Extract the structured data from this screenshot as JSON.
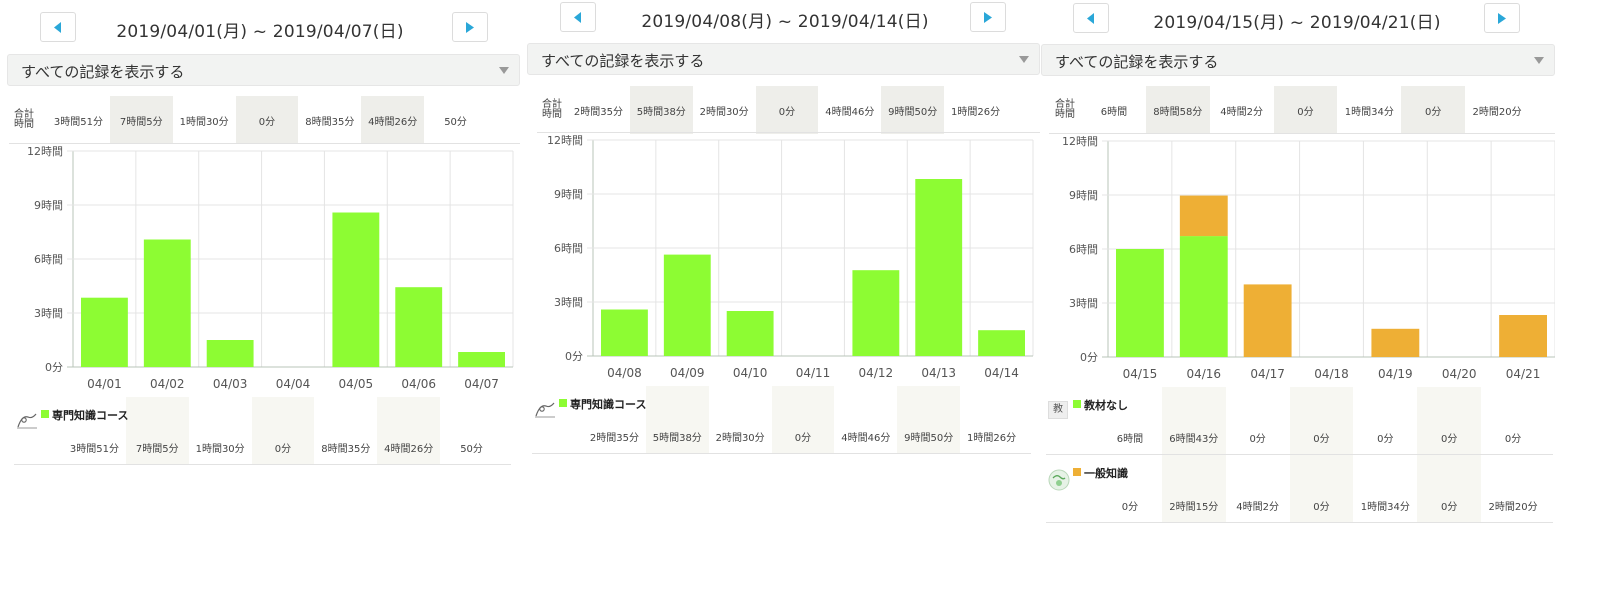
{
  "filter_label": "すべての記録を表示する",
  "total_label": "合計時間",
  "colors": {
    "green": "#8dfc33",
    "orange": "#eeaf35",
    "grid": "#e4e4e4",
    "axis": "#b8c4b8"
  },
  "panels": [
    {
      "title": "2019/04/01(月) ~ 2019/04/07(日)",
      "totals": [
        "3時間51分",
        "7時間5分",
        "1時間30分",
        "0分",
        "8時間35分",
        "4時間26分",
        "50分"
      ],
      "legend": [
        {
          "name": "専門知識コース",
          "icon": "course-icon",
          "color": "green",
          "values": [
            "3時間51分",
            "7時間5分",
            "1時間30分",
            "0分",
            "8時間35分",
            "4時間26分",
            "50分"
          ]
        }
      ]
    },
    {
      "title": "2019/04/08(月) ~ 2019/04/14(日)",
      "totals": [
        "2時間35分",
        "5時間38分",
        "2時間30分",
        "0分",
        "4時間46分",
        "9時間50分",
        "1時間26分"
      ],
      "legend": [
        {
          "name": "専門知識コース",
          "icon": "course-icon",
          "color": "green",
          "values": [
            "2時間35分",
            "5時間38分",
            "2時間30分",
            "0分",
            "4時間46分",
            "9時間50分",
            "1時間26分"
          ]
        }
      ]
    },
    {
      "title": "2019/04/15(月) ~ 2019/04/21(日)",
      "totals": [
        "6時間",
        "8時間58分",
        "4時間2分",
        "0分",
        "1時間34分",
        "0分",
        "2時間20分"
      ],
      "legend": [
        {
          "name": "教材なし",
          "icon": "textbook-icon",
          "icon_text": "教",
          "color": "green",
          "values": [
            "6時間",
            "6時間43分",
            "0分",
            "0分",
            "0分",
            "0分",
            "0分"
          ]
        },
        {
          "name": "一般知識",
          "icon": "globe-icon",
          "color": "orange",
          "values": [
            "0分",
            "2時間15分",
            "4時間2分",
            "0分",
            "1時間34分",
            "0分",
            "2時間20分"
          ]
        }
      ]
    }
  ],
  "chart_data": [
    {
      "type": "bar",
      "stacked": true,
      "categories": [
        "04/01",
        "04/02",
        "04/03",
        "04/04",
        "04/05",
        "04/06",
        "04/07"
      ],
      "yticks": [
        "0分",
        "3時間",
        "6時間",
        "9時間",
        "12時間"
      ],
      "ylim": [
        0,
        12
      ],
      "y_unit": "hours",
      "grid": true,
      "series": [
        {
          "name": "専門知識コース",
          "color": "#8dfc33",
          "values": [
            3.85,
            7.083,
            1.5,
            0,
            8.583,
            4.433,
            0.833
          ]
        }
      ]
    },
    {
      "type": "bar",
      "stacked": true,
      "categories": [
        "04/08",
        "04/09",
        "04/10",
        "04/11",
        "04/12",
        "04/13",
        "04/14"
      ],
      "yticks": [
        "0分",
        "3時間",
        "6時間",
        "9時間",
        "12時間"
      ],
      "ylim": [
        0,
        12
      ],
      "y_unit": "hours",
      "grid": true,
      "series": [
        {
          "name": "専門知識コース",
          "color": "#8dfc33",
          "values": [
            2.583,
            5.633,
            2.5,
            0,
            4.767,
            9.833,
            1.433
          ]
        }
      ]
    },
    {
      "type": "bar",
      "stacked": true,
      "categories": [
        "04/15",
        "04/16",
        "04/17",
        "04/18",
        "04/19",
        "04/20",
        "04/21"
      ],
      "yticks": [
        "0分",
        "3時間",
        "6時間",
        "9時間",
        "12時間"
      ],
      "ylim": [
        0,
        12
      ],
      "y_unit": "hours",
      "grid": true,
      "series": [
        {
          "name": "教材なし",
          "color": "#8dfc33",
          "values": [
            6,
            6.717,
            0,
            0,
            0,
            0,
            0
          ]
        },
        {
          "name": "一般知識",
          "color": "#eeaf35",
          "values": [
            0,
            2.25,
            4.033,
            0,
            1.567,
            0,
            2.333
          ]
        }
      ]
    }
  ]
}
